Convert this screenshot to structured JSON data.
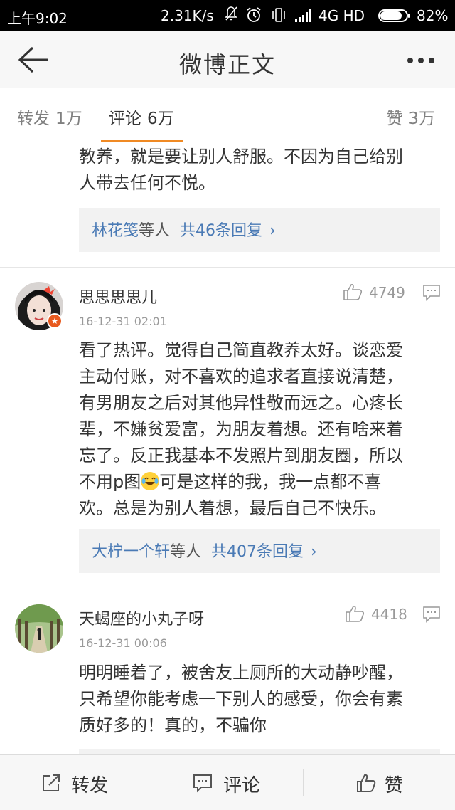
{
  "status_bar": {
    "time": "上午9:02",
    "speed": "2.31K/s",
    "network": "4G HD",
    "battery": "82%",
    "battery_level": 0.82
  },
  "nav": {
    "title": "微博正文",
    "back_icon": "arrow-left-icon",
    "more_icon": "more-dots-icon"
  },
  "tabs": {
    "repost_label": "转发",
    "repost_count": "1万",
    "comment_label": "评论",
    "comment_count": "6万",
    "like_label": "赞",
    "like_count": "3万",
    "active": "comment",
    "accent_color": "#f08a24"
  },
  "top_partial": {
    "text_line1": "教养，就是要让别人舒服。不因为自己给别",
    "text_line2": "人带去任何不悦。",
    "reply_names": "林花笺",
    "reply_etc": "等人",
    "reply_count": "共46条回复"
  },
  "comments": [
    {
      "user": "思思思思儿",
      "time": "16-12-31 02:01",
      "likes": "4749",
      "lines": [
        "看了热评。觉得自己简直教养太好。谈恋爱",
        "主动付账，对不喜欢的追求者直接说清楚，",
        "有男朋友之后对其他异性敬而远之。心疼长",
        "辈，不嫌贫爱富，为朋友着想。还有啥来着",
        "忘了。反正我基本不发照片到朋友圈，所以"
      ],
      "line6_before_emoji": "不用p图",
      "line6_after_emoji": "可是这样的我，我一点都不喜",
      "line7": "欢。总是为别人着想，最后自己不快乐。",
      "reply_names": "大柠一个轩",
      "reply_etc": "等人",
      "reply_count": "共407条回复"
    },
    {
      "user": "天蝎座的小丸子呀",
      "time": "16-12-31 00:06",
      "likes": "4418",
      "lines": [
        "明明睡着了，被舍友上厕所的大动静吵醒，",
        "只希望你能考虑一下别人的感受，你会有素",
        "质好多的！真的，不骗你"
      ]
    }
  ],
  "reply_chevron": "›",
  "bottom_bar": {
    "repost": "转发",
    "comment": "评论",
    "like": "赞"
  }
}
